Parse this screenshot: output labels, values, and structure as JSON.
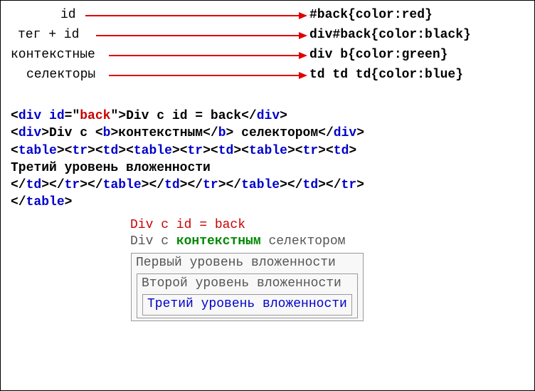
{
  "diagram": {
    "rows": [
      {
        "label": "id",
        "code": "#back{color:red}"
      },
      {
        "label": "тег + id",
        "code": "div#back{color:black}"
      },
      {
        "label": "контекстные",
        "code": "div b{color:green}"
      },
      {
        "label": "селекторы",
        "code": "td td td{color:blue}"
      }
    ]
  },
  "html_source": {
    "div_tag": "div",
    "id_attr": "id",
    "id_val": "back",
    "div1_text": "Div c id = back",
    "div2_a": "Div c ",
    "b_tag": "b",
    "div2_b": "контекстным",
    "div2_c": " селектором",
    "table_tag": "table",
    "tr_tag": "tr",
    "td_tag": "td",
    "nested_text": "Третий уровень вложенности"
  },
  "render": {
    "line1": "Div c id = back",
    "line2_a": "Div c ",
    "line2_b": "контекстным",
    "line2_c": " селектором",
    "level1": "Первый уровень вложенности",
    "level2": "Второй уровень вложенности",
    "level3": "Третий уровень вложенности"
  }
}
